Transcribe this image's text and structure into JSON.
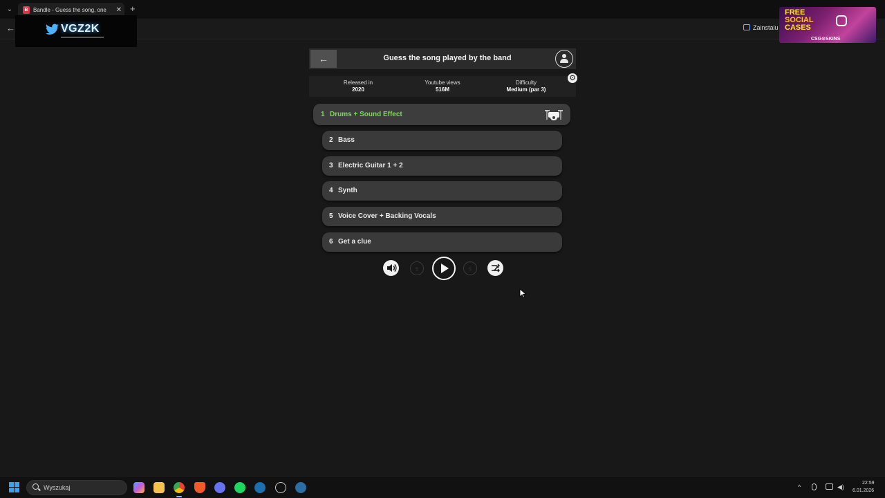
{
  "browser": {
    "tab_title": "Bandle - Guess the song, one in",
    "tab_favicon": "B",
    "tab_close": "✕",
    "new_tab": "+",
    "tab_menu": "⌄",
    "nav_back": "←",
    "install_label": "Zainstalu"
  },
  "overlay": {
    "logo_text": "VGZ2K",
    "ad_line1": "FREE",
    "ad_line2": "SOCIAL",
    "ad_line3": "CASES",
    "ad_brand": "CSG⊙SKINS"
  },
  "game": {
    "back_icon": "←",
    "title": "Guess the song played by the band",
    "info": {
      "released_label": "Released in",
      "released_value": "2020",
      "views_label": "Youtube views",
      "views_value": "516M",
      "difficulty_label": "Difficulty",
      "difficulty_value": "Medium (par 3)"
    },
    "settings_icon": "⚙",
    "tracks": [
      {
        "num": "1",
        "label": "Drums + Sound Effect",
        "active": true
      },
      {
        "num": "2",
        "label": "Bass"
      },
      {
        "num": "3",
        "label": "Electric Guitar 1 + 2"
      },
      {
        "num": "4",
        "label": "Synth"
      },
      {
        "num": "5",
        "label": "Voice Cover + Backing Vocals"
      },
      {
        "num": "6",
        "label": "Get a clue"
      }
    ],
    "active_color": "#7ed957"
  },
  "taskbar": {
    "search_placeholder": "Wyszukaj",
    "time": "22:59",
    "date": "6.01.2026",
    "apps": [
      "copilot-icon",
      "file-explorer-icon",
      "chrome-icon",
      "brave-icon",
      "discord-icon",
      "spotify-icon",
      "steam-icon",
      "app-icon",
      "steam-icon"
    ]
  }
}
